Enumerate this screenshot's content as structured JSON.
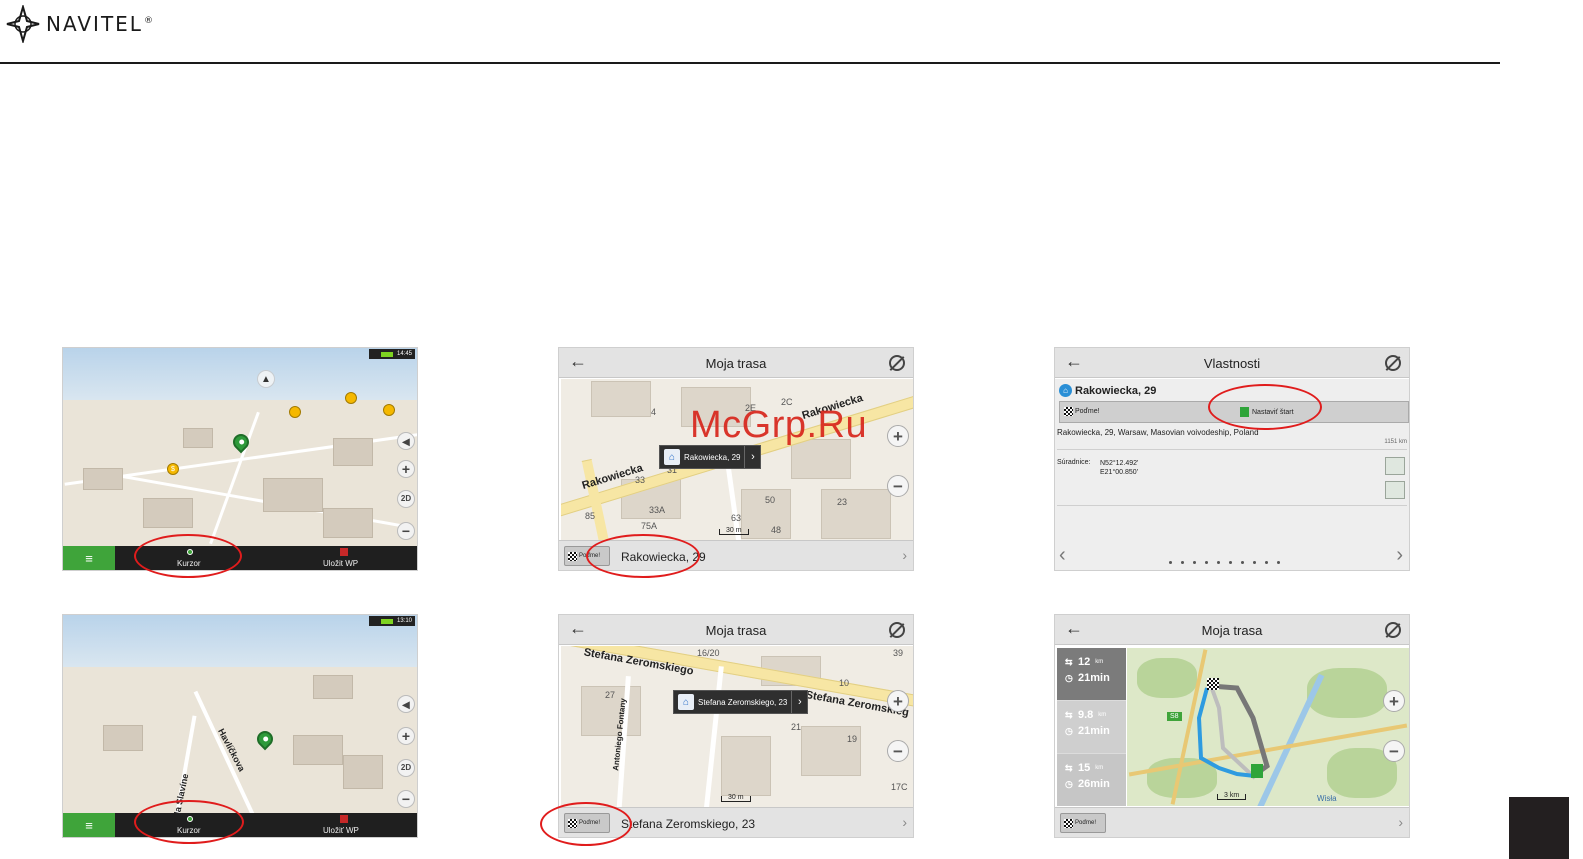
{
  "header": {
    "brand": "NAVITEL",
    "trademark": "®"
  },
  "watermark": "McGrp.Ru",
  "colors": {
    "callout": "#e01c1c",
    "accent_green": "#3fa43a",
    "page_tab": "#231f20"
  },
  "screens": {
    "s1": {
      "status_time": "14:45",
      "bottom_left_label": "Kurzor",
      "bottom_right_label": "Uložit WP",
      "side_buttons": [
        "+",
        "2D",
        "−"
      ]
    },
    "s2": {
      "title": "Moja trasa",
      "go_label": "Poďme!",
      "address": "Rakowiecka, 29",
      "popup": "Rakowiecka, 29",
      "street_names": [
        "Rakowiecka",
        "Rakowiecka"
      ],
      "scale": "30 m",
      "house_numbers": [
        "4",
        "2E",
        "2C",
        "33",
        "31",
        "33A",
        "75A",
        "85",
        "50",
        "23",
        "63",
        "48"
      ]
    },
    "s3": {
      "title": "Vlastnosti",
      "place": "Rakowiecka, 29",
      "go_label": "Poďme!",
      "start_label": "Nastaviť štart",
      "full_address": "Rakowiecka, 29, Warsaw, Masovian voivodeship, Poland",
      "distance": "1151 km",
      "coord_label": "Súradnice:",
      "lat": "N52°12.492'",
      "lon": "E21°00.850'"
    },
    "s4": {
      "status_time": "13:10",
      "bottom_left_label": "Kurzor",
      "bottom_right_label": "Uložiť WP",
      "street_names": [
        "Havlíčkova",
        "Na Slavíne"
      ]
    },
    "s5": {
      "title": "Moja trasa",
      "go_label": "Poďme!",
      "address": "Stefana Zeromskiego, 23",
      "popup": "Stefana Zeromskiego, 23",
      "street_names": [
        "Stefana Zeromskiego",
        "Stefana Zeromskieg",
        "Antoniego Fontany"
      ],
      "scale": "30 m",
      "house_numbers": [
        "16/20",
        "27",
        "10",
        "21",
        "19",
        "17C",
        "39"
      ]
    },
    "s6": {
      "title": "Moja trasa",
      "go_label": "Poďme!",
      "routes": [
        {
          "dist": "12",
          "unit": "km",
          "time": "21min"
        },
        {
          "dist": "9.8",
          "unit": "km",
          "time": "21min"
        },
        {
          "dist": "15",
          "unit": "km",
          "time": "26min"
        }
      ],
      "scale": "3 km",
      "river_label": "Wisła",
      "road_badge": "S8"
    }
  }
}
